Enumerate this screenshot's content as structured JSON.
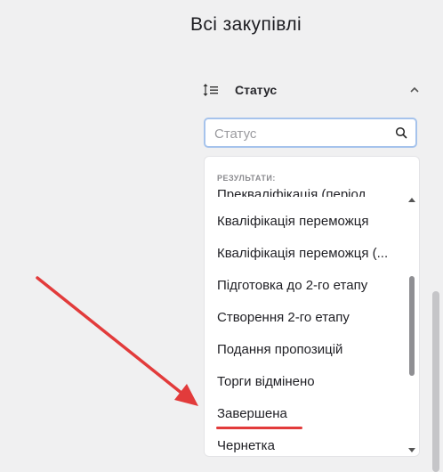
{
  "page": {
    "title": "Всі закупівлі"
  },
  "filter": {
    "label": "Статус",
    "icon": "sort-list-icon",
    "toggle_icon": "chevron-up-icon",
    "search": {
      "placeholder": "Статус",
      "value": "",
      "icon": "search-icon"
    },
    "results_label": "РЕЗУЛЬТАТИ:",
    "options": [
      "Прекваліфікація (період ...",
      "Кваліфікація переможця",
      "Кваліфікація переможця (...",
      "Підготовка до 2-го етапу",
      "Створення 2-го етапу",
      "Подання пропозицій",
      "Торги відмінено",
      "Завершена",
      "Чернетка"
    ],
    "highlighted_option": "Завершена"
  },
  "annotation": {
    "arrow_color": "#e23b3b",
    "underline_color": "#e23b3b"
  },
  "colors": {
    "background": "#f0f0f1",
    "focus_border": "#a6c3ec",
    "accent": "#e23b3b"
  }
}
